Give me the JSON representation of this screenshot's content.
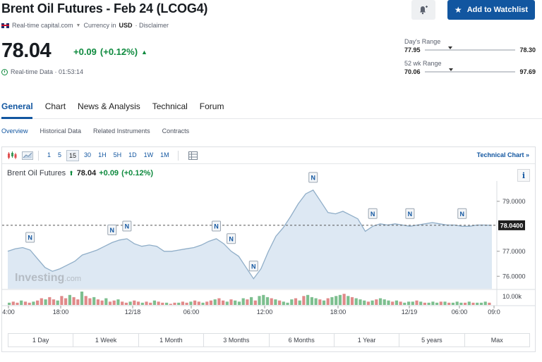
{
  "header": {
    "title": "Brent Oil Futures - Feb 24 (LCOG4)",
    "watchlist_label": "Add to Watchlist",
    "source": "Real-time capital.com",
    "currency_prefix": "Currency in",
    "currency": "USD",
    "disclaimer": "· Disclaimer"
  },
  "quote": {
    "price": "78.04",
    "change": "+0.09",
    "change_pct": "(+0.12%)",
    "data_label": "Real-time Data · 01:53:14"
  },
  "ranges": {
    "day": {
      "label": "Day's Range",
      "low": "77.95",
      "high": "78.30",
      "position": 0.26
    },
    "week52": {
      "label": "52 wk Range",
      "low": "70.06",
      "high": "97.69",
      "position": 0.27
    }
  },
  "tabs": [
    "General",
    "Chart",
    "News & Analysis",
    "Technical",
    "Forum"
  ],
  "subtabs": [
    "Overview",
    "Historical Data",
    "Related Instruments",
    "Contracts"
  ],
  "toolbar": {
    "timeframes": [
      "1",
      "5",
      "15",
      "30",
      "1H",
      "5H",
      "1D",
      "1W",
      "1M"
    ],
    "active_timeframe": "15",
    "technical_chart": "Technical Chart »"
  },
  "chart_header": {
    "name": "Brent Oil Futures",
    "price": "78.04",
    "change": "+0.09",
    "change_pct": "(+0.12%)"
  },
  "watermark": {
    "main": "Investing",
    "suffix": ".com"
  },
  "chart_data": {
    "type": "area",
    "x_ticks": [
      "4:00",
      "18:00",
      "12/18",
      "06:00",
      "12:00",
      "18:00",
      "12/19",
      "06:00",
      "09:0"
    ],
    "y_ticks": [
      "79.0000",
      "77.0000",
      "76.0000"
    ],
    "current_price_label": "78.0400",
    "volume_tick": "10.00k",
    "ylim": [
      75.5,
      79.7
    ],
    "series": [
      {
        "values": [
          77.0,
          77.1,
          77.15,
          77.05,
          76.7,
          76.35,
          76.2,
          76.3,
          76.45,
          76.6,
          76.85,
          76.95,
          77.05,
          77.2,
          77.35,
          77.45,
          77.5,
          77.3,
          77.2,
          77.25,
          77.2,
          77.0,
          77.0,
          77.05,
          77.1,
          77.15,
          77.25,
          77.4,
          77.5,
          77.3,
          77.0,
          76.8,
          76.35,
          75.9,
          76.3,
          77.0,
          77.6,
          77.95,
          78.4,
          78.9,
          79.3,
          79.45,
          79.0,
          78.55,
          78.5,
          78.6,
          78.45,
          78.3,
          77.8,
          78.0,
          78.1,
          78.05,
          78.1,
          78.05,
          78.0,
          78.05,
          78.1,
          78.15,
          78.1,
          78.05,
          78.05,
          78.0,
          78.0,
          78.05,
          78.05,
          78.04
        ]
      }
    ],
    "volumes": [
      2,
      3,
      2,
      4,
      3,
      2,
      3,
      4,
      6,
      5,
      7,
      5,
      4,
      8,
      6,
      9,
      7,
      5,
      12,
      8,
      6,
      7,
      5,
      4,
      6,
      3,
      4,
      5,
      3,
      2,
      3,
      4,
      3,
      2,
      3,
      2,
      4,
      3,
      2,
      2,
      1,
      2,
      2,
      3,
      2,
      3,
      4,
      3,
      2,
      3,
      4,
      5,
      6,
      4,
      3,
      5,
      4,
      3,
      6,
      5,
      7,
      4,
      8,
      9,
      7,
      6,
      5,
      4,
      3,
      2,
      5,
      6,
      4,
      8,
      9,
      7,
      6,
      5,
      4,
      6,
      7,
      8,
      9,
      10,
      8,
      7,
      6,
      5,
      4,
      3,
      4,
      5,
      6,
      5,
      4,
      3,
      4,
      3,
      2,
      3,
      3,
      4,
      3,
      2,
      2,
      3,
      2,
      3,
      3,
      2,
      2,
      3,
      2,
      2,
      3,
      2,
      2,
      2,
      3,
      2
    ],
    "news_markers": [
      {
        "x_index": 3,
        "label": "N"
      },
      {
        "x_index": 14,
        "label": "N"
      },
      {
        "x_index": 16,
        "label": "N"
      },
      {
        "x_index": 28,
        "label": "N"
      },
      {
        "x_index": 30,
        "label": "N"
      },
      {
        "x_index": 33,
        "label": "N"
      },
      {
        "x_index": 41,
        "label": "N"
      },
      {
        "x_index": 49,
        "label": "N"
      },
      {
        "x_index": 54,
        "label": "N"
      },
      {
        "x_index": 61,
        "label": "N"
      }
    ],
    "colors": {
      "line": "#90aec8",
      "fill": "#dde8f3",
      "up": "#7dbf8f",
      "down": "#e08a8a"
    }
  }
}
